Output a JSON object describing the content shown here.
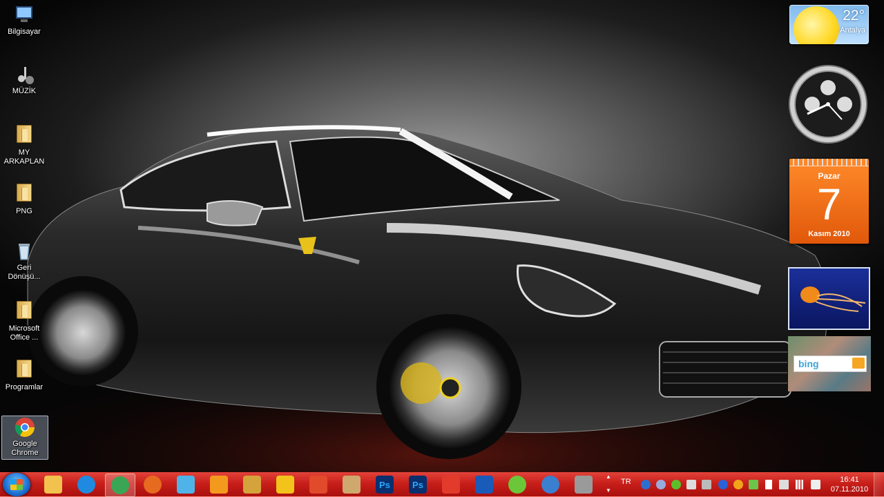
{
  "desktop_icons": [
    {
      "label": "Bilgisayar",
      "icon": "computer-icon"
    },
    {
      "label": "MÜZİK",
      "icon": "music-folder-icon"
    },
    {
      "label": "MY ARKAPLAN",
      "icon": "folder-icon"
    },
    {
      "label": "PNG",
      "icon": "folder-icon"
    },
    {
      "label": "Geri Dönüşü...",
      "icon": "recycle-bin-icon"
    },
    {
      "label": "Microsoft Office ...",
      "icon": "folder-icon"
    },
    {
      "label": "Programlar",
      "icon": "folder-icon"
    },
    {
      "label": "Google Chrome",
      "icon": "chrome-icon"
    }
  ],
  "gadgets": {
    "weather": {
      "temperature": "22°",
      "city": "Antalya"
    },
    "calendar": {
      "day_name": "Pazar",
      "day_number": "7",
      "month_year": "Kasım 2010"
    },
    "bing": {
      "logo": "bing"
    }
  },
  "taskbar": {
    "pinned": [
      {
        "name": "windows-explorer-icon",
        "color": "#f2c14e"
      },
      {
        "name": "internet-explorer-icon",
        "color": "#1f8ae0"
      },
      {
        "name": "chrome-icon",
        "color": "#3aa655",
        "active": true
      },
      {
        "name": "firefox-icon",
        "color": "#e66a1f"
      },
      {
        "name": "messenger-icon",
        "color": "#4fb3e8"
      },
      {
        "name": "media-player-icon",
        "color": "#f39a1e"
      },
      {
        "name": "archive-icon",
        "color": "#d5a33b"
      },
      {
        "name": "winamp-icon",
        "color": "#f2c31a"
      },
      {
        "name": "burn-icon",
        "color": "#e14a2a"
      },
      {
        "name": "paint-icon",
        "color": "#cfa870"
      },
      {
        "name": "photoshop-icon",
        "color": "#0a2f6e",
        "text": "Ps"
      },
      {
        "name": "photoshop-icon-2",
        "color": "#0a2f6e",
        "text": "Ps"
      },
      {
        "name": "office-icon",
        "color": "#e23b2b"
      },
      {
        "name": "window-capture-icon",
        "color": "#1a5ab8"
      },
      {
        "name": "globe-icon",
        "color": "#6cc63a"
      },
      {
        "name": "avast-icon",
        "color": "#3a7fd0"
      },
      {
        "name": "counter-strike-icon",
        "color": "#9a9a9a"
      }
    ],
    "language": "TR",
    "time": "16:41",
    "date": "07.11.2010"
  }
}
